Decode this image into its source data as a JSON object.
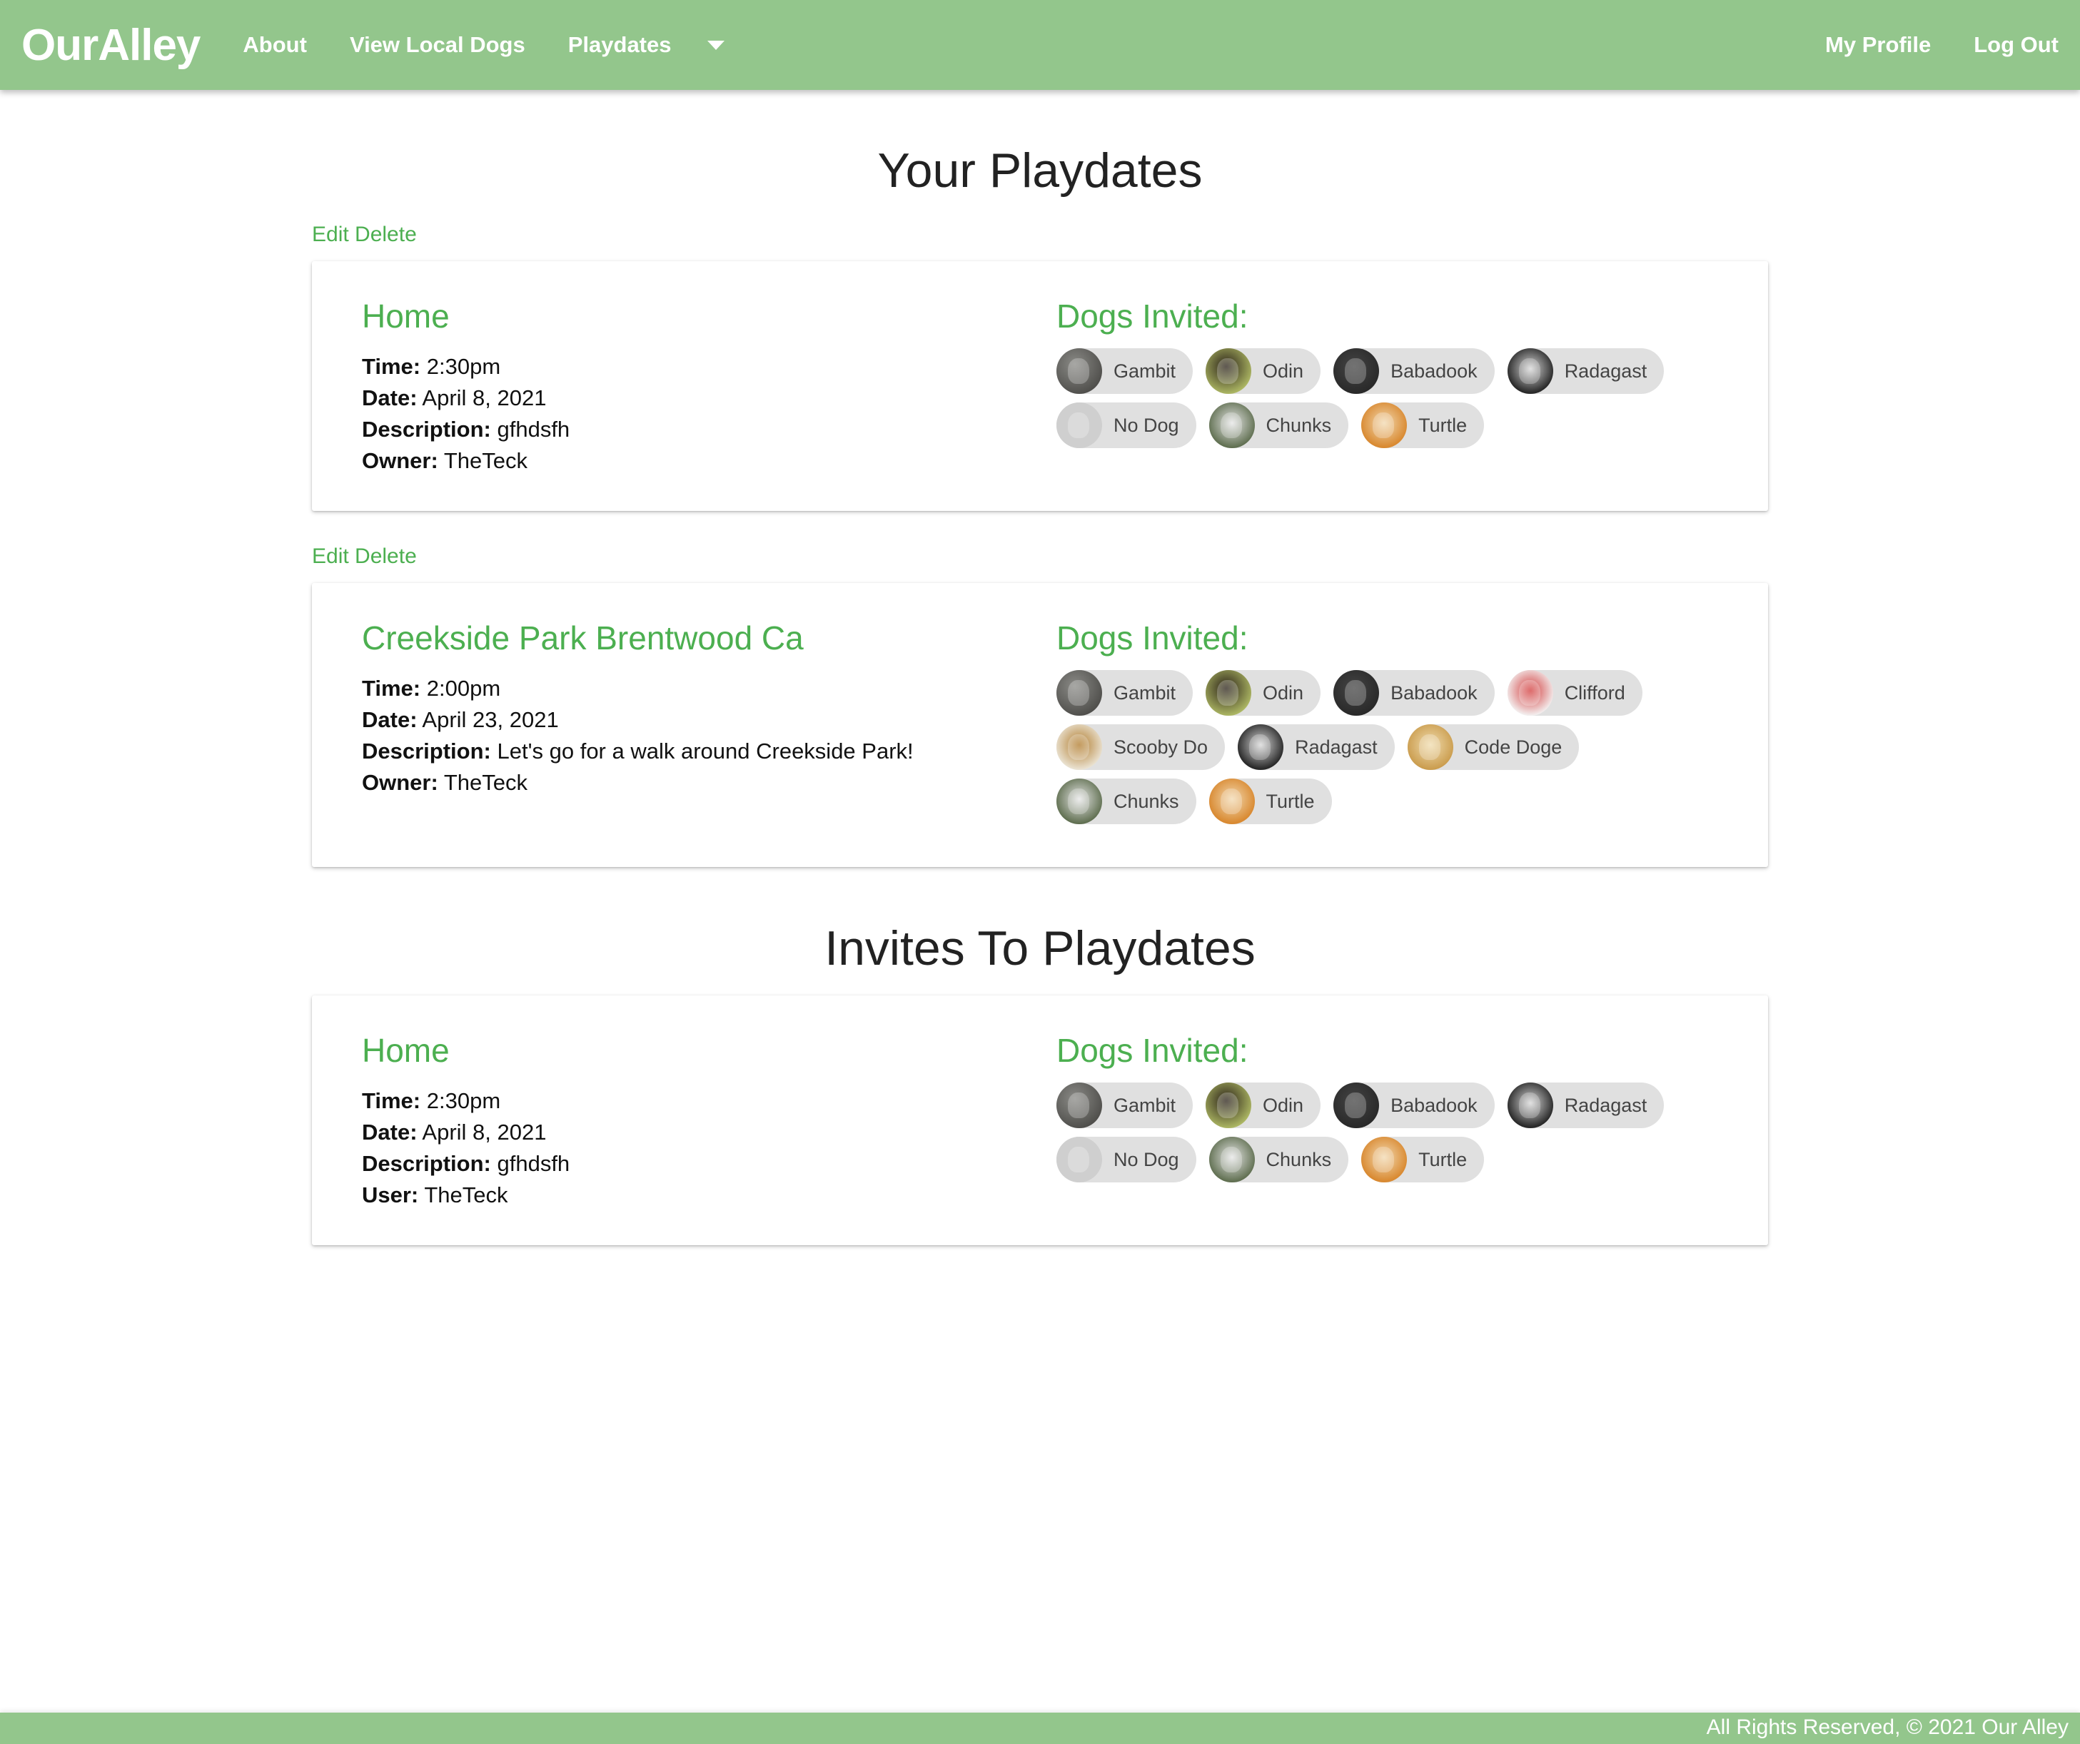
{
  "nav": {
    "brand": "OurAlley",
    "about": "About",
    "view_local_dogs": "View Local Dogs",
    "playdates": "Playdates",
    "my_profile": "My Profile",
    "log_out": "Log Out"
  },
  "your_playdates": {
    "title": "Your Playdates",
    "edit": "Edit",
    "delete": "Delete",
    "playdates": [
      {
        "location": "Home",
        "time_label": "Time:",
        "time": "2:30pm",
        "date_label": "Date:",
        "date": "April 8, 2021",
        "description_label": "Description:",
        "description": "gfhdsfh",
        "owner_label": "Owner:",
        "owner": "TheTeck",
        "dogs_label": "Dogs Invited:",
        "dogs": [
          "Gambit",
          "Odin",
          "Babadook",
          "Radagast",
          "No Dog",
          "Chunks",
          "Turtle"
        ]
      },
      {
        "location": "Creekside Park Brentwood Ca",
        "time_label": "Time:",
        "time": "2:00pm",
        "date_label": "Date:",
        "date": "April 23, 2021",
        "description_label": "Description:",
        "description": "Let's go for a walk around Creekside Park!",
        "owner_label": "Owner:",
        "owner": "TheTeck",
        "dogs_label": "Dogs Invited:",
        "dogs": [
          "Gambit",
          "Odin",
          "Babadook",
          "Clifford",
          "Scooby Do",
          "Radagast",
          "Code Doge",
          "Chunks",
          "Turtle"
        ]
      }
    ]
  },
  "invites": {
    "title": "Invites To Playdates",
    "playdates": [
      {
        "location": "Home",
        "time_label": "Time:",
        "time": "2:30pm",
        "date_label": "Date:",
        "date": "April 8, 2021",
        "description_label": "Description:",
        "description": "gfhdsfh",
        "user_label": "User:",
        "user": "TheTeck",
        "dogs_label": "Dogs Invited:",
        "dogs": [
          "Gambit",
          "Odin",
          "Babadook",
          "Radagast",
          "No Dog",
          "Chunks",
          "Turtle"
        ]
      }
    ]
  },
  "footer": {
    "text": "All Rights Reserved, © 2021 Our Alley"
  },
  "colors": {
    "navbar": "#93c68c",
    "accent": "#4caf50",
    "chip": "#e0e0e0"
  }
}
